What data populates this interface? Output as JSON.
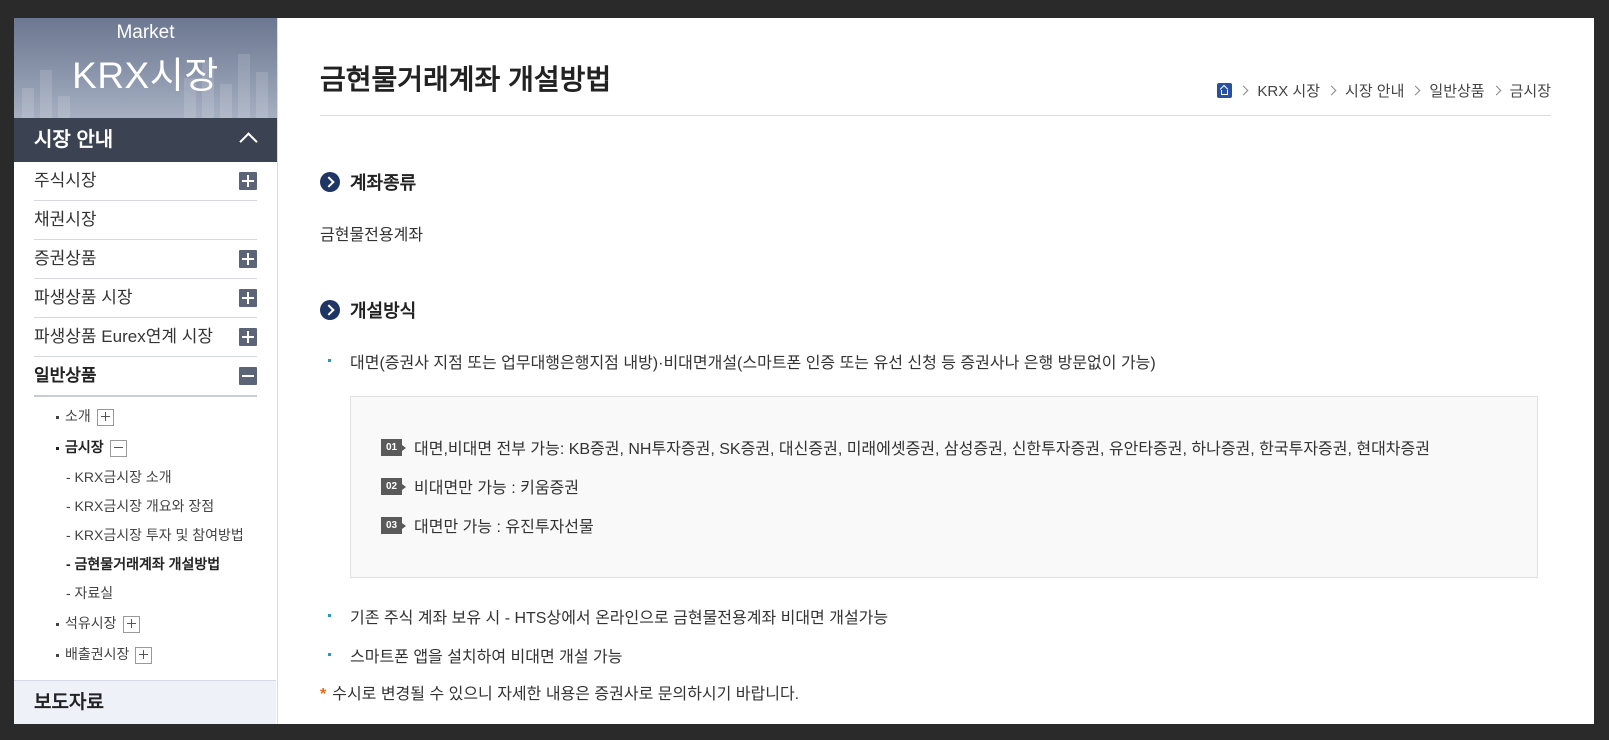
{
  "sidebar": {
    "banner_small": "Market",
    "banner_big": "KRX시장",
    "section_title": "시장 안내",
    "menu": [
      {
        "label": "주식시장",
        "toggle": "plus"
      },
      {
        "label": "채권시장",
        "toggle": "none"
      },
      {
        "label": "증권상품",
        "toggle": "plus"
      },
      {
        "label": "파생상품 시장",
        "toggle": "plus"
      },
      {
        "label": "파생상품 Eurex연계 시장",
        "toggle": "plus"
      },
      {
        "label": "일반상품",
        "toggle": "minus"
      }
    ],
    "sub": {
      "intro": "소개",
      "gold_market": "금시장",
      "gold_children": [
        "- KRX금시장 소개",
        "- KRX금시장 개요와 장점",
        "- KRX금시장 투자 및 참여방법",
        "- 금현물거래계좌 개설방법",
        "- 자료실"
      ],
      "oil_market": "석유시장",
      "emission_market": "배출권시장"
    },
    "press": "보도자료"
  },
  "main": {
    "title": "금현물거래계좌 개설방법",
    "breadcrumb": [
      "KRX 시장",
      "시장 안내",
      "일반상품",
      "금시장"
    ],
    "section1": {
      "heading": "계좌종류",
      "text": "금현물전용계좌"
    },
    "section2": {
      "heading": "개설방식",
      "bullet1": "대면(증권사 지점 또는 업무대행은행지점 내방)·비대면개설(스마트폰 인증 또는 유선 신청 등 증권사나 은행 방문없이 가능)",
      "box": [
        {
          "num": "01",
          "text": "대면,비대면 전부 가능: KB증권, NH투자증권, SK증권, 대신증권, 미래에셋증권, 삼성증권, 신한투자증권, 유안타증권, 하나증권, 한국투자증권, 현대차증권"
        },
        {
          "num": "02",
          "text": "비대면만 가능 : 키움증권"
        },
        {
          "num": "03",
          "text": "대면만 가능 : 유진투자선물"
        }
      ],
      "bullet2": "기존 주식 계좌 보유 시 - HTS상에서 온라인으로 금현물전용계좌 비대면 개설가능",
      "bullet3": "스마트폰 앱을 설치하여 비대면 개설 가능"
    },
    "note_star": "*",
    "note": "수시로 변경될 수 있으니 자세한 내용은 증권사로 문의하시기 바랍니다."
  }
}
